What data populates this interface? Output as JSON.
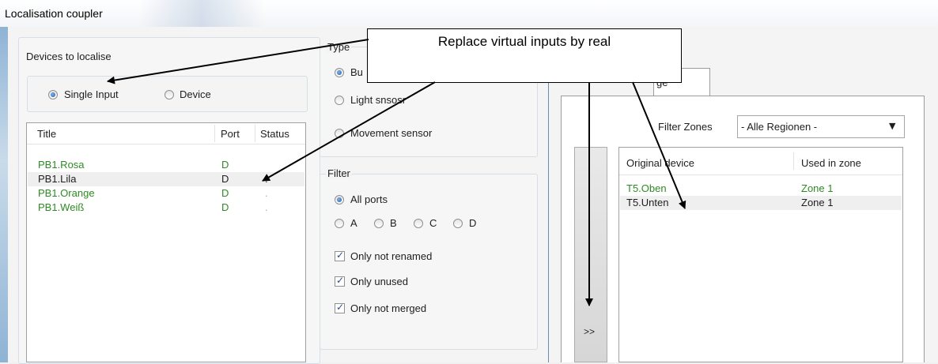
{
  "window": {
    "title": "Localisation coupler"
  },
  "devices_group": {
    "legend": "Devices to localise",
    "mode_single": "Single Input",
    "mode_device": "Device",
    "columns": [
      "Title",
      "Port",
      "Status"
    ],
    "rows": [
      {
        "title": "PB1.Rosa",
        "port": "D",
        "status": "",
        "color": "#2e8a24"
      },
      {
        "title": "PB1.Lila",
        "port": "D",
        "status": ".",
        "color": "#1e1e1e"
      },
      {
        "title": "PB1.Orange",
        "port": "D",
        "status": ".",
        "color": "#2e8a24"
      },
      {
        "title": "PB1.Weiß",
        "port": "D",
        "status": ".",
        "color": "#2e8a24"
      }
    ]
  },
  "type_group": {
    "legend": "Type",
    "option_button": "Bu",
    "option_light": "Light snsosr",
    "option_movement": "Movement sensor"
  },
  "filter_group": {
    "legend": "Filter",
    "all_ports": "All ports",
    "port_a": "A",
    "port_b": "B",
    "port_c": "C",
    "port_d": "D",
    "only_not_renamed": "Only not renamed",
    "only_unused": "Only unused",
    "only_not_merged": "Only not merged"
  },
  "right_panel": {
    "tab_label": "ge",
    "filter_zones_label": "Filter Zones",
    "filter_zones_value": "- Alle Regionen -",
    "transfer_button": ">>",
    "columns": [
      "Original device",
      "Used in zone"
    ],
    "rows": [
      {
        "device": "T5.Oben",
        "zone": "Zone 1",
        "color": "#2e8a24"
      },
      {
        "device": "T5.Unten",
        "zone": "Zone 1",
        "color": "#1e1e1e"
      }
    ]
  },
  "annotation": {
    "callout_text": "Replace virtual inputs by real"
  }
}
